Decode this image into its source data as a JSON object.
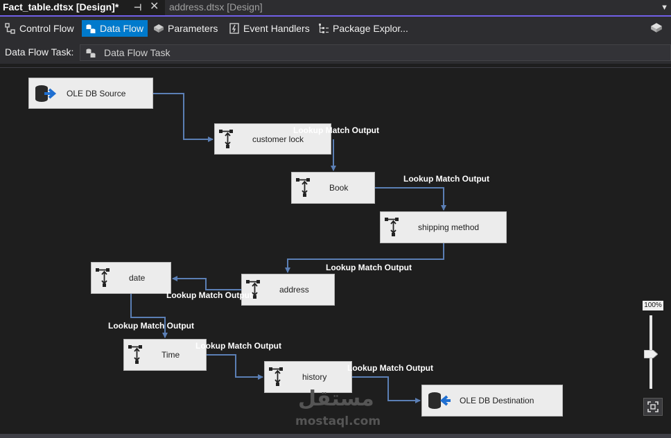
{
  "tabs": {
    "active": "Fact_table.dtsx [Design]*",
    "inactive": "address.dtsx [Design]"
  },
  "designer_tabs": [
    {
      "label": "Control Flow",
      "icon": "control-flow-icon",
      "selected": false
    },
    {
      "label": "Data Flow",
      "icon": "data-flow-icon",
      "selected": true
    },
    {
      "label": "Parameters",
      "icon": "parameters-icon",
      "selected": false
    },
    {
      "label": "Event Handlers",
      "icon": "event-handlers-icon",
      "selected": false
    },
    {
      "label": "Package Explor...",
      "icon": "package-explorer-icon",
      "selected": false
    }
  ],
  "task": {
    "label": "Data Flow Task:",
    "value": "Data Flow Task"
  },
  "components": {
    "source": "OLE DB Source",
    "customer_lock": "customer lock",
    "book": "Book",
    "shipping_method": "shipping method",
    "address": "address",
    "date": "date",
    "time": "Time",
    "history": "history",
    "destination": "OLE DB Destination"
  },
  "path_label": "Lookup Match Output",
  "zoom": {
    "readout": "100%",
    "level": 1.0
  },
  "watermark": {
    "arabic": "مستقل",
    "latin": "mostaql.com"
  },
  "colors": {
    "accent": "#007acc",
    "tab_underline": "#7160e8",
    "flow_arrow": "#5b7fb5",
    "background": "#1e1e1e"
  }
}
